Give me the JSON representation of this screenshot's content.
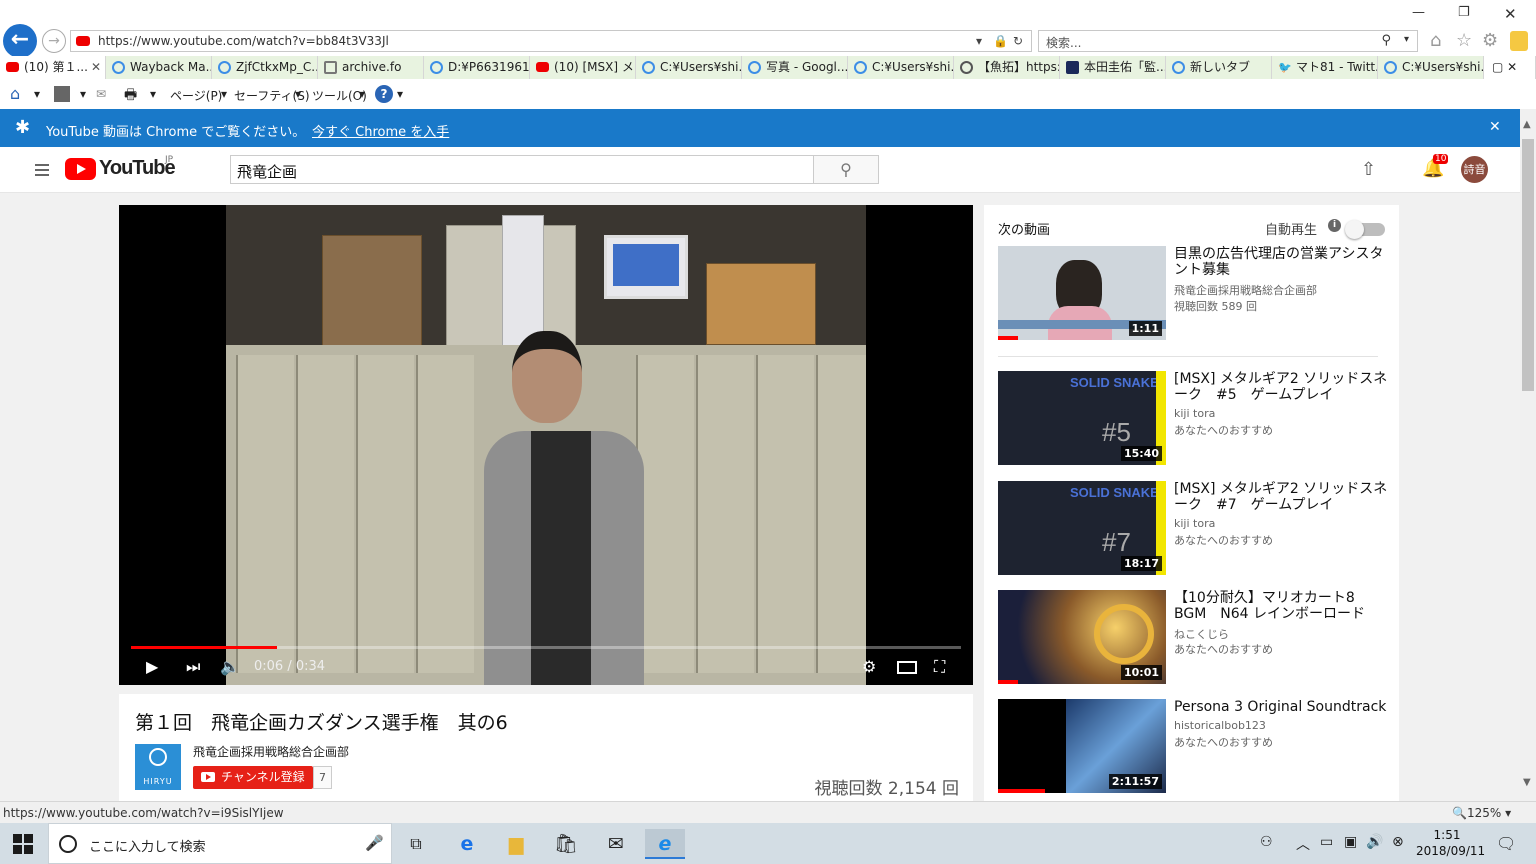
{
  "browser": {
    "url": "https://www.youtube.com/watch?v=bb84t3V33Jl",
    "search_placeholder": "検索...",
    "tabs": [
      {
        "label": "(10) 第１...",
        "icon": "youtube-icon",
        "active": true
      },
      {
        "label": "Wayback Ma...",
        "icon": "ie-page-icon"
      },
      {
        "label": "ZjfCtkxMp_C...",
        "icon": "ie-page-icon"
      },
      {
        "label": "archive.fo",
        "icon": "archive-icon"
      },
      {
        "label": "D:¥P6631961...",
        "icon": "ie-page-icon"
      },
      {
        "label": "(10) [MSX] メ...",
        "icon": "youtube-icon"
      },
      {
        "label": "C:¥Users¥shi...",
        "icon": "ie-page-icon"
      },
      {
        "label": "写真 - Googl...",
        "icon": "ie-page-icon"
      },
      {
        "label": "C:¥Users¥shi...",
        "icon": "ie-page-icon"
      },
      {
        "label": "【魚拓】https:/...",
        "icon": "fish-icon"
      },
      {
        "label": "本田圭佑「監...",
        "icon": "news-icon"
      },
      {
        "label": "新しいタブ",
        "icon": "ie-page-icon"
      },
      {
        "label": "マト81 - Twitt...",
        "icon": "twitter-icon"
      },
      {
        "label": "C:¥Users¥shi...",
        "icon": "ie-page-icon"
      }
    ],
    "command_bar": {
      "page": "ページ(P)",
      "safety": "セーフティ(S)",
      "tools": "ツール(O)"
    },
    "status_url": "https://www.youtube.com/watch?v=i9SislYIjew",
    "zoom": "125%"
  },
  "banner": {
    "message": "YouTube 動画は Chrome でご覧ください。",
    "link": "今すぐ Chrome を入手",
    "color": "#1979c9"
  },
  "youtube": {
    "logo_text": "YouTube",
    "region": "JP",
    "search_query": "飛竜企画",
    "notification_count": "10",
    "avatar_text": "詩音",
    "accent": "#ff0000"
  },
  "player": {
    "time": "0:06 / 0:34",
    "progress_fraction": 0.176
  },
  "video": {
    "title": "第１回　飛竜企画カズダンス選手権　其の6",
    "channel_name": "飛竜企画採用戦略総合企画部",
    "channel_logo_text": "HIRYU",
    "subscribe_label": "チャンネル登録",
    "subscriber_count": "7",
    "views": "視聴回数 2,154 回"
  },
  "sidebar": {
    "next_label": "次の動画",
    "autoplay_label": "自動再生",
    "items": [
      {
        "title": "目黒の広告代理店の営業アシスタント募集",
        "channel": "飛竜企画採用戦略総合企画部",
        "meta": "視聴回数 589 回",
        "duration": "1:11",
        "watched_fraction": 0.12
      },
      {
        "title": "[MSX] メタルギア2 ソリッドスネーク　#5　ゲームプレイ",
        "channel": "kiji tora",
        "meta": "あなたへのおすすめ",
        "duration": "15:40",
        "episode": "#5",
        "watched_fraction": 0
      },
      {
        "title": "[MSX] メタルギア2 ソリッドスネーク　#7　ゲームプレイ",
        "channel": "kiji tora",
        "meta": "あなたへのおすすめ",
        "duration": "18:17",
        "episode": "#7",
        "watched_fraction": 0
      },
      {
        "title": "【10分耐久】マリオカート8 BGM　N64 レインボーロード",
        "channel": "ねこくじら",
        "meta": "あなたへのおすすめ",
        "duration": "10:01",
        "watched_fraction": 0.12
      },
      {
        "title": "Persona 3 Original Soundtrack",
        "channel": "historicalbob123",
        "meta": "あなたへのおすすめ",
        "duration": "2:11:57",
        "watched_fraction": 0.28
      }
    ]
  },
  "taskbar": {
    "search_placeholder": "ここに入力して検索",
    "time": "1:51",
    "date": "2018/09/11"
  }
}
